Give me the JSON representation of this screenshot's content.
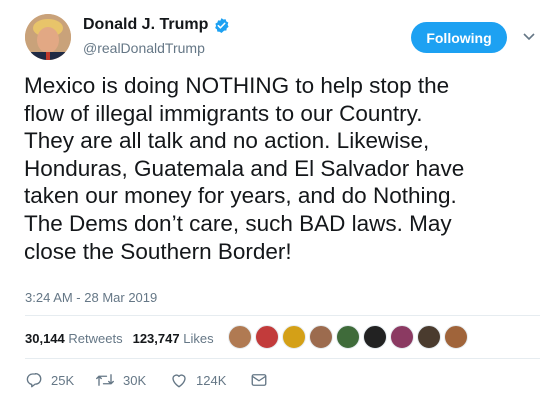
{
  "header": {
    "display_name": "Donald J. Trump",
    "handle": "@realDonaldTrump",
    "follow_label": "Following",
    "verified_icon": "verified-badge-icon",
    "colors": {
      "accent": "#1da1f2",
      "text": "#14171a",
      "muted": "#657786"
    }
  },
  "tweet": {
    "text": "Mexico is doing NOTHING to help stop the\nflow of illegal immigrants to our Country.\nThey are all talk and no action. Likewise,\nHonduras, Guatemala and El Salvador have\ntaken our money for years, and do Nothing.\nThe Dems don’t care, such BAD laws. May\nclose the Southern Border!",
    "timestamp": "3:24 AM - 28 Mar 2019"
  },
  "stats": {
    "retweets_count": "30,144",
    "retweets_label": "Retweets",
    "likes_count": "123,747",
    "likes_label": "Likes",
    "liker_avatars": [
      {
        "color": "#b07a52"
      },
      {
        "color": "#c23b3b"
      },
      {
        "color": "#d4a017"
      },
      {
        "color": "#9c6b4e"
      },
      {
        "color": "#3f6b3a"
      },
      {
        "color": "#222222"
      },
      {
        "color": "#8b3a62"
      },
      {
        "color": "#4a3b2e"
      },
      {
        "color": "#a0643a"
      }
    ]
  },
  "actions": {
    "reply_count": "25K",
    "retweet_count": "30K",
    "like_count": "124K",
    "icons": [
      "reply-icon",
      "retweet-icon",
      "like-icon",
      "direct-message-icon"
    ]
  }
}
